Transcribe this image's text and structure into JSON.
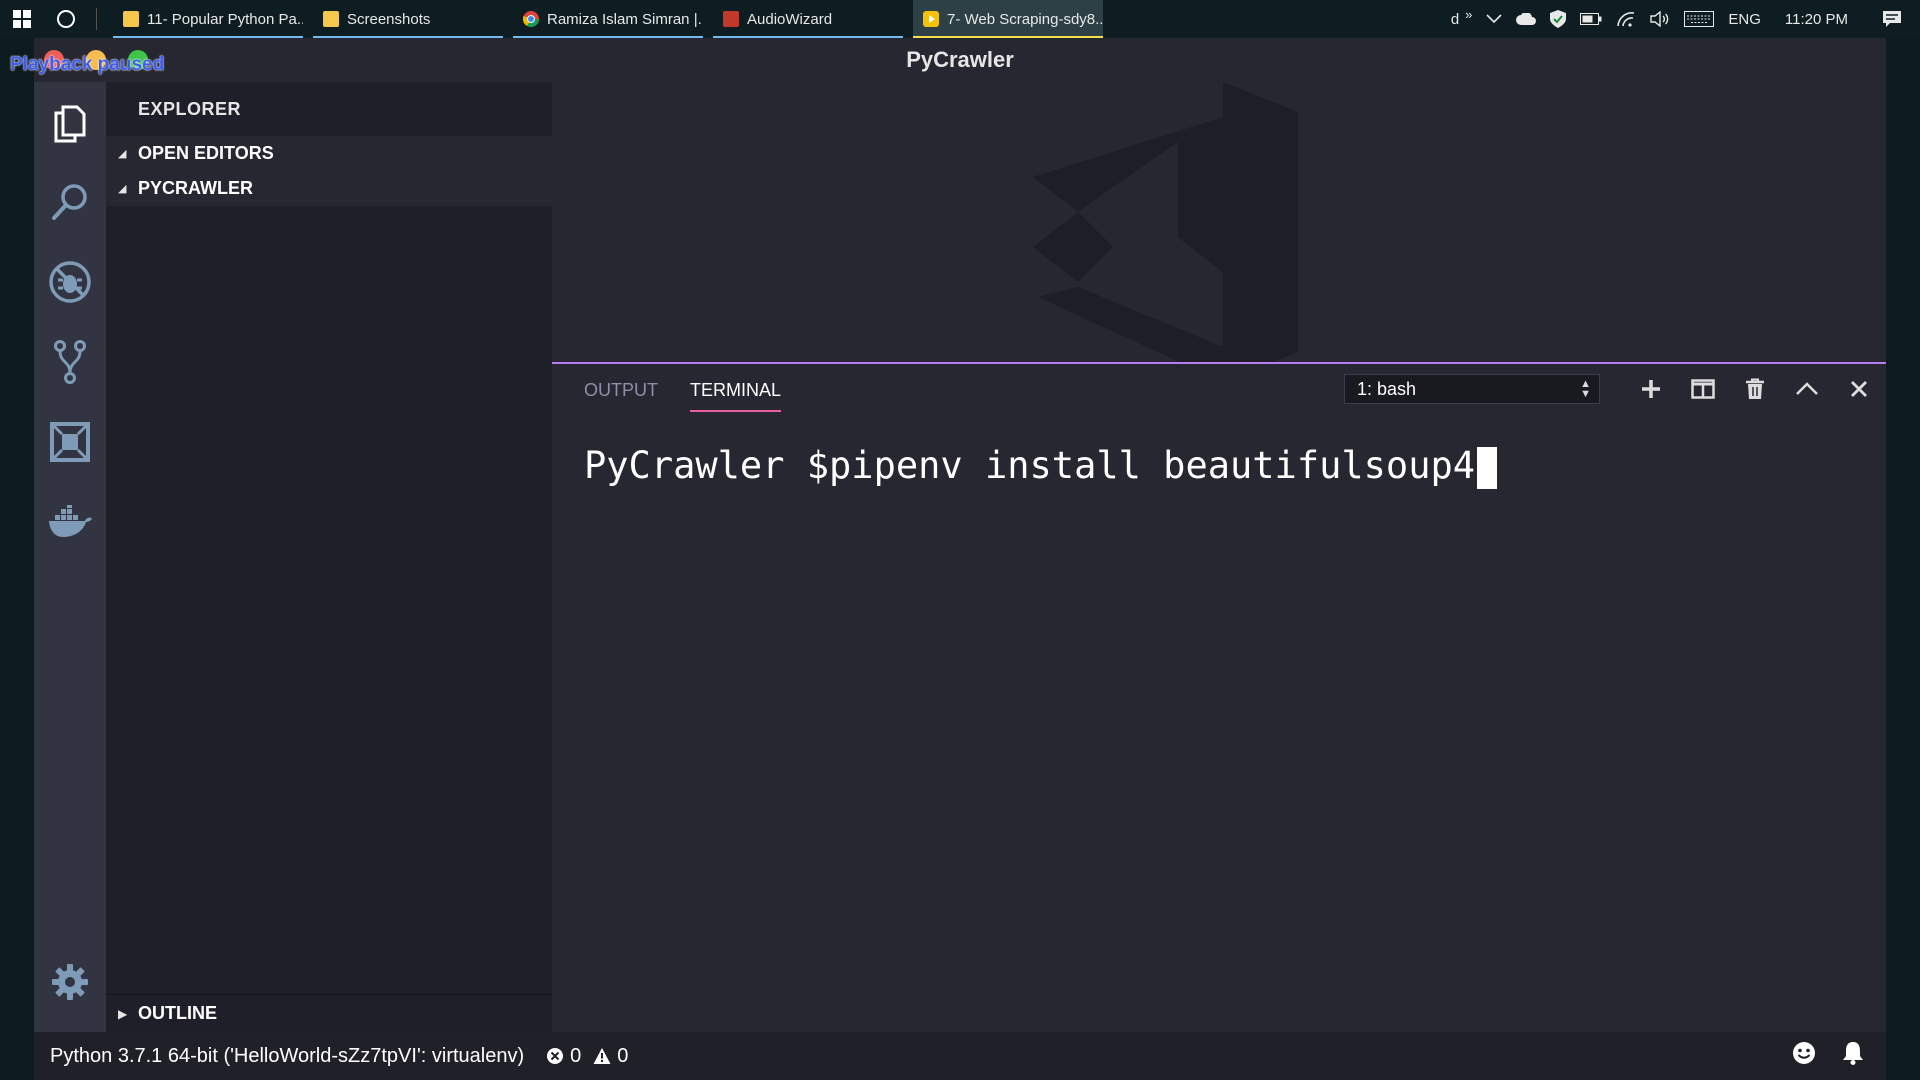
{
  "taskbar": {
    "apps": [
      {
        "label": "11- Popular Python Pa...",
        "icon": "folder-icon",
        "color": "#f3c84c",
        "active": false
      },
      {
        "label": "Screenshots",
        "icon": "folder-icon",
        "color": "#f3c84c",
        "active": false
      },
      {
        "label": "Ramiza Islam Simran |...",
        "icon": "chrome-icon",
        "color": "#4a8fe8",
        "active": false
      },
      {
        "label": "AudioWizard",
        "icon": "audiowizard-icon",
        "color": "#c0392b",
        "active": false
      },
      {
        "label": "7- Web Scraping-sdy8...",
        "icon": "media-player-icon",
        "color": "#f4c20d",
        "active": true
      }
    ],
    "tray": {
      "user_initial": "d",
      "overflow": "»",
      "language": "ENG",
      "time": "11:20 PM"
    }
  },
  "window": {
    "title": "PyCrawler",
    "playback_text": "Playback paused",
    "traffic_colors": [
      "#ee5f57",
      "#f6be4f",
      "#3ec54a"
    ]
  },
  "sidebar": {
    "header": "EXPLORER",
    "sections": [
      "OPEN EDITORS",
      "PYCRAWLER"
    ],
    "outline": "OUTLINE"
  },
  "panel": {
    "tabs": [
      {
        "label": "OUTPUT",
        "active": false
      },
      {
        "label": "TERMINAL",
        "active": true
      }
    ],
    "terminal_select": "1: bash",
    "terminal_line": "PyCrawler $pipenv install beautifulsoup4"
  },
  "statusbar": {
    "python": "Python 3.7.1 64-bit ('HelloWorld-sZz7tpVI': virtualenv)",
    "errors": "0",
    "warnings": "0"
  },
  "colors": {
    "accent_panel_border": "#b87af0",
    "active_tab_underline": "#e65fa3",
    "activity_bar": "#333442",
    "icon_color": "#7e9bb8"
  }
}
